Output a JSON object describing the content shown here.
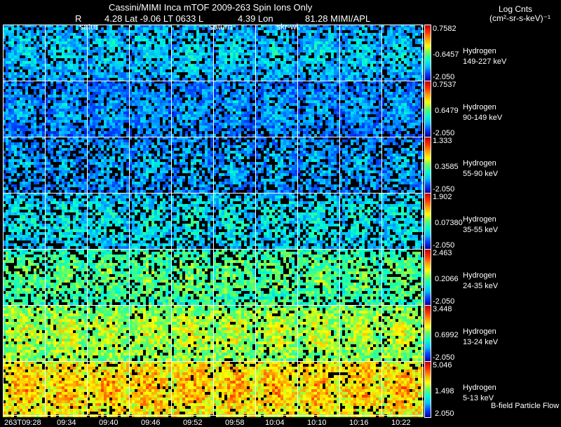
{
  "header": {
    "title": "Cassini/MIMI Inca mTOF  2009-263   Spin   Ions Only",
    "r_label": "R",
    "ephem": "4.28 Lat -9.06 LT 0633 L",
    "lon": "4.39 Lon",
    "lon_val": "81.28  MIMI/APL",
    "overlays": [
      "satur",
      "saturn",
      "skr-wl"
    ]
  },
  "colorbar_title": [
    "Log Cnts",
    "(cm²-sr-s-keV)⁻¹"
  ],
  "footer_note": "B-field Particle Flow",
  "chart_data": {
    "type": "heatmap",
    "x_tick_labels": [
      "263T09:28",
      "09:34",
      "09:40",
      "09:46",
      "09:52",
      "09:58",
      "10:04",
      "10:10",
      "10:16",
      "10:22"
    ],
    "panels": [
      {
        "species": "Hydrogen",
        "energy": "149-227 keV",
        "cmax": "0.7582",
        "cmid": "-0.6457",
        "cmin": "-2.050",
        "typical_level": 0.25,
        "fill_fraction": 0.85
      },
      {
        "species": "Hydrogen",
        "energy": "90-149 keV",
        "cmax": "0.7537",
        "cmid": "0.6479",
        "cmin": "-2.050",
        "typical_level": 0.18,
        "fill_fraction": 0.85
      },
      {
        "species": "Hydrogen",
        "energy": "55-90 keV",
        "cmax": "1.333",
        "cmid": "0.3585",
        "cmin": "-2.050",
        "typical_level": 0.2,
        "fill_fraction": 0.72
      },
      {
        "species": "Hydrogen",
        "energy": "35-55 keV",
        "cmax": "1.902",
        "cmid": "0.07380",
        "cmin": "-2.050",
        "typical_level": 0.3,
        "fill_fraction": 0.75
      },
      {
        "species": "Hydrogen",
        "energy": "24-35 keV",
        "cmax": "2.463",
        "cmid": "0.2066",
        "cmin": "-2.050",
        "typical_level": 0.45,
        "fill_fraction": 0.8
      },
      {
        "species": "Hydrogen",
        "energy": "13-24 keV",
        "cmax": "3.448",
        "cmid": "0.6992",
        "cmin": "-2.050",
        "typical_level": 0.55,
        "fill_fraction": 0.93
      },
      {
        "species": "Hydrogen",
        "energy": "5-13 keV",
        "cmax": "5.046",
        "cmid": "1.498",
        "cmin": "2.050",
        "typical_level": 0.68,
        "fill_fraction": 0.95
      }
    ]
  }
}
